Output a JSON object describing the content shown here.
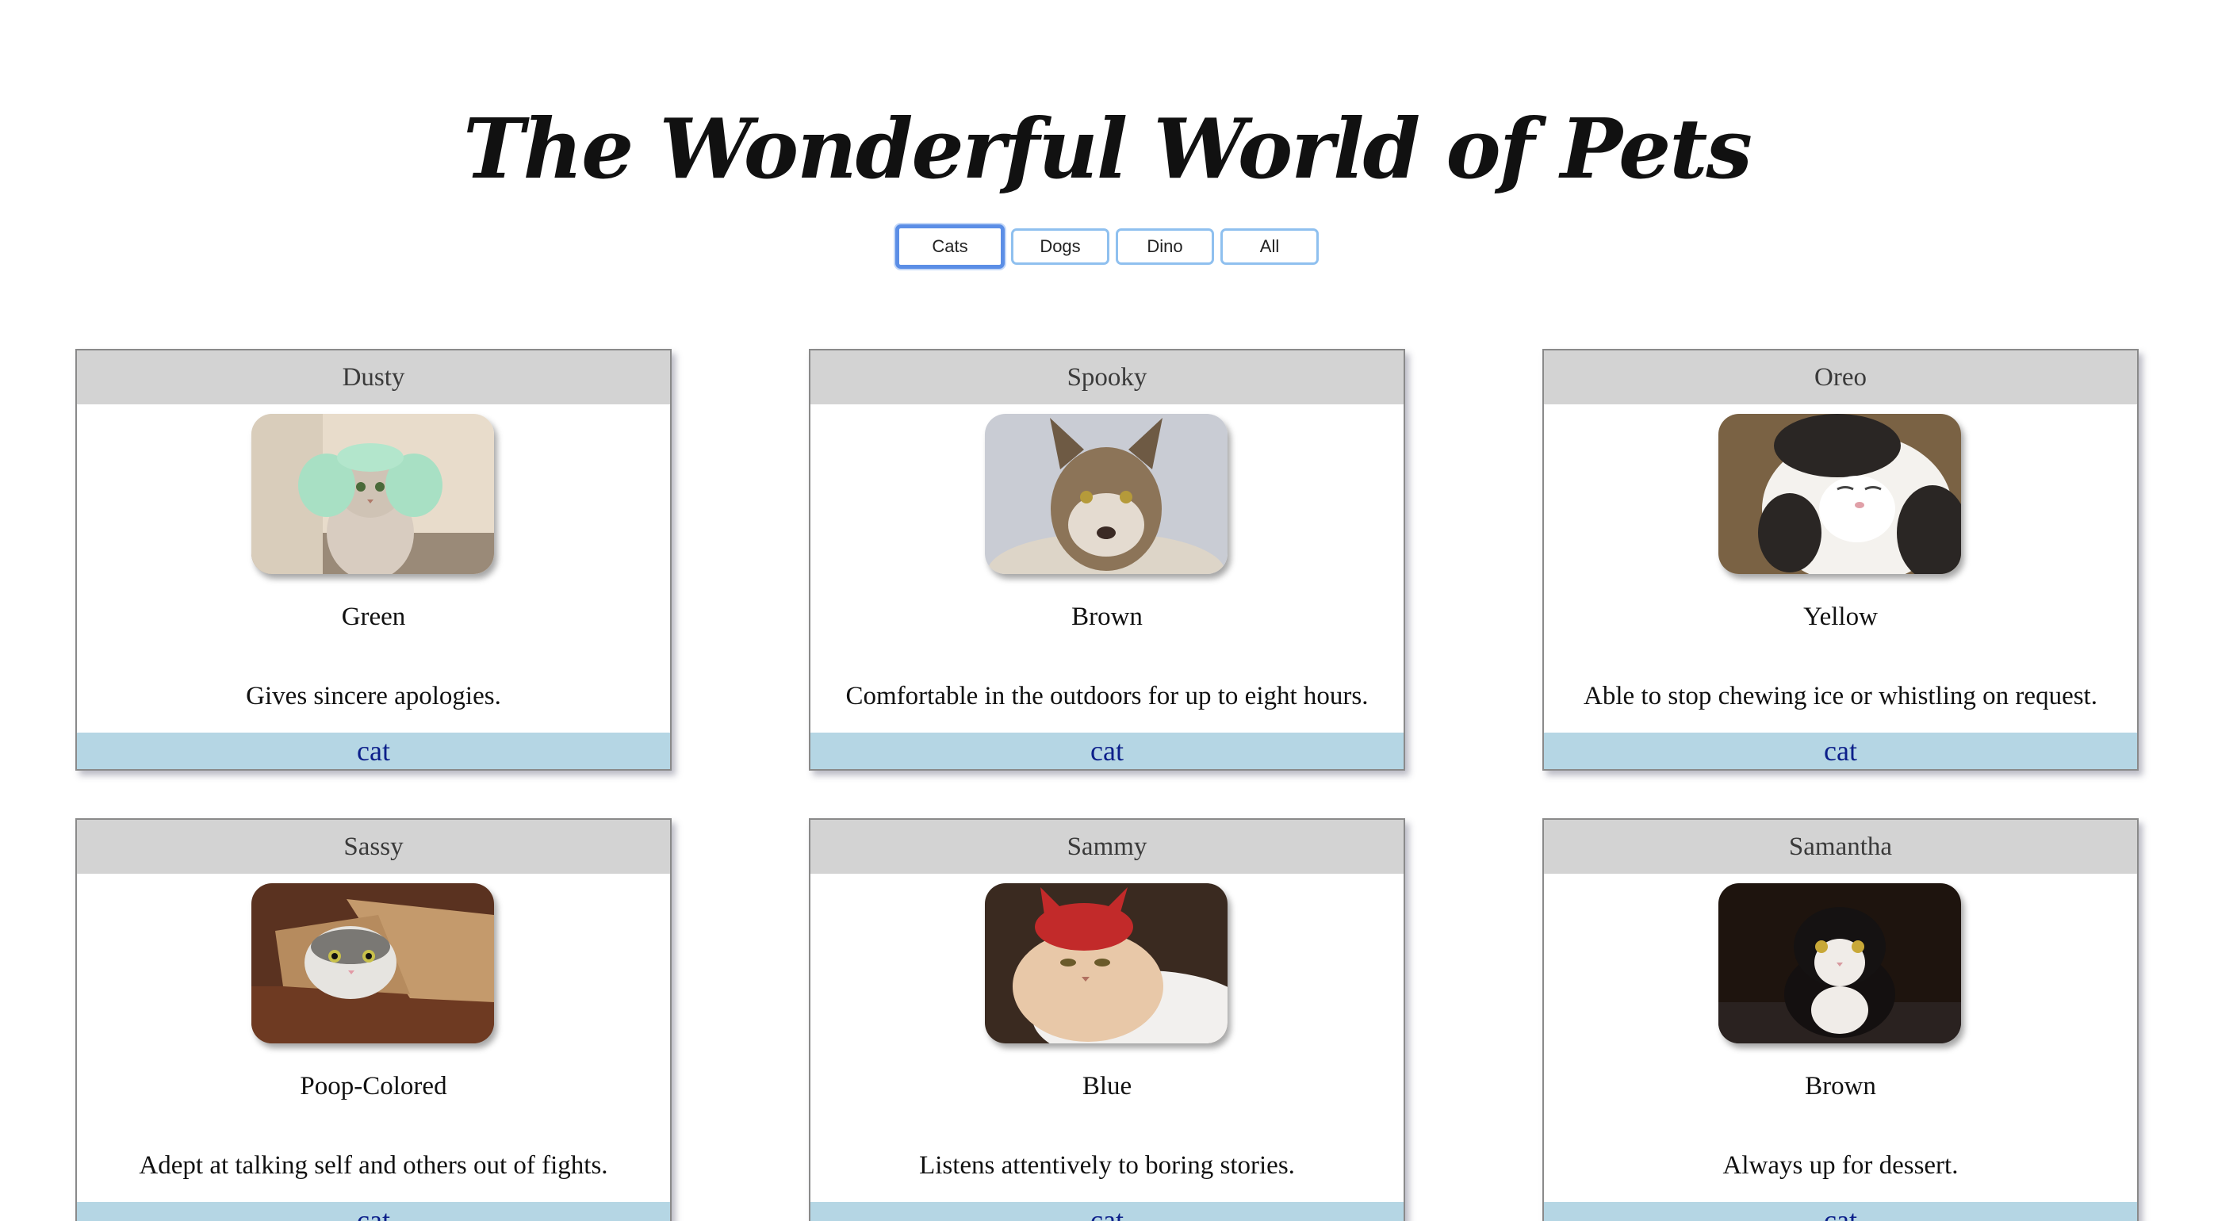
{
  "page": {
    "title": "The Wonderful World of Pets"
  },
  "filters": [
    {
      "label": "Cats",
      "active": true
    },
    {
      "label": "Dogs",
      "active": false
    },
    {
      "label": "Dino",
      "active": false
    },
    {
      "label": "All",
      "active": false
    }
  ],
  "pets": [
    {
      "name": "Dusty",
      "color": "Green",
      "description": "Gives sincere apologies.",
      "type": "cat"
    },
    {
      "name": "Spooky",
      "color": "Brown",
      "description": "Comfortable in the outdoors for up to eight hours.",
      "type": "cat"
    },
    {
      "name": "Oreo",
      "color": "Yellow",
      "description": "Able to stop chewing ice or whistling on request.",
      "type": "cat"
    },
    {
      "name": "Sassy",
      "color": "Poop-Colored",
      "description": "Adept at talking self and others out of fights.",
      "type": "cat"
    },
    {
      "name": "Sammy",
      "color": "Blue",
      "description": "Listens attentively to boring stories.",
      "type": "cat"
    },
    {
      "name": "Samantha",
      "color": "Brown",
      "description": "Always up for dessert.",
      "type": "cat"
    }
  ]
}
